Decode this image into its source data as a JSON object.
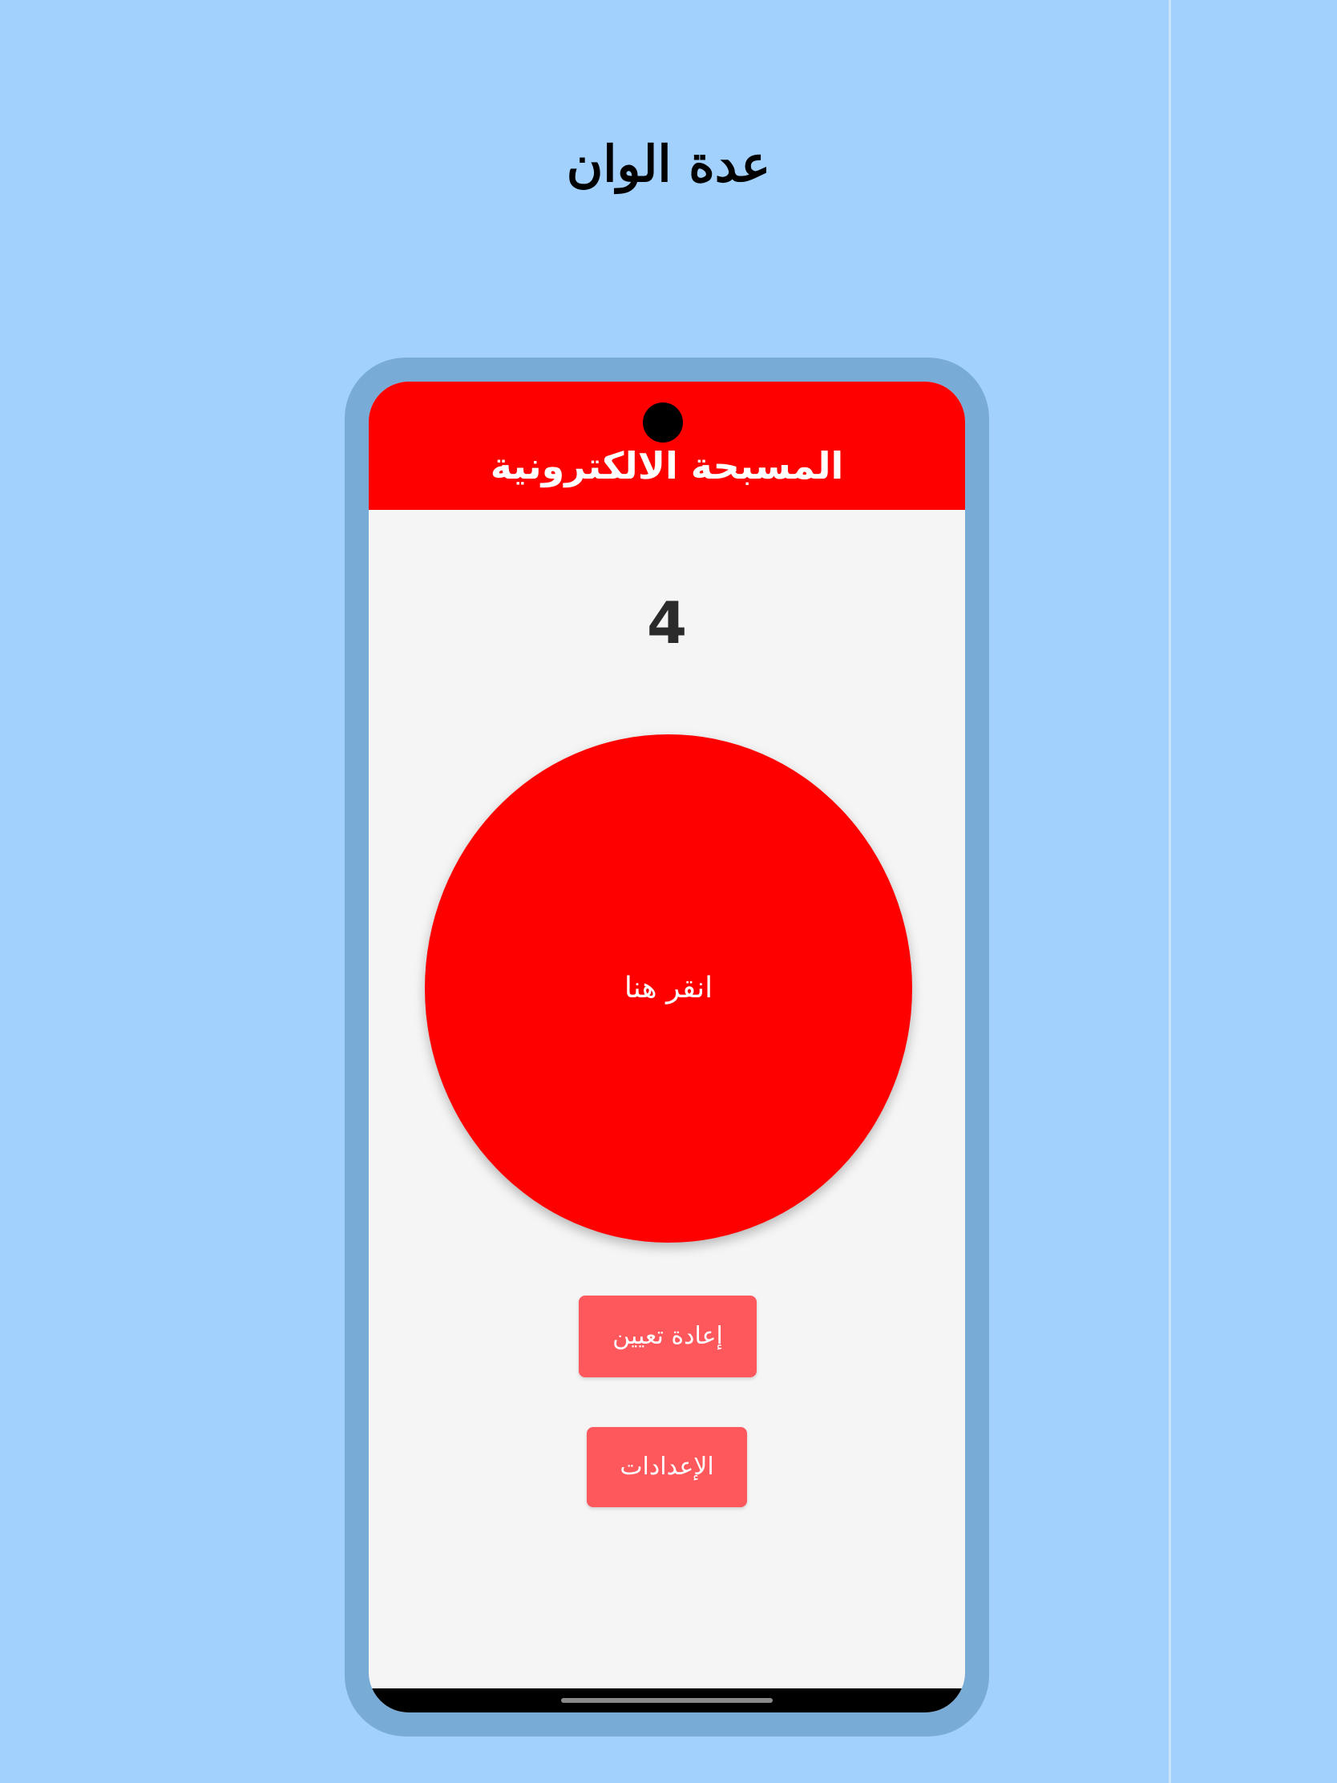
{
  "page": {
    "title": "عدة الوان"
  },
  "app": {
    "title": "المسبحة الالكترونية",
    "counter": "4",
    "tap_label": "انقر هنا",
    "reset_label": "إعادة تعيين",
    "settings_label": "الإعدادات"
  },
  "colors": {
    "background": "#a3d1fd",
    "phone_frame": "#78abd5",
    "app_bar": "#ff0000",
    "tap_button": "#ff0000",
    "action_button": "#ff585c",
    "screen": "#f5f5f5"
  }
}
